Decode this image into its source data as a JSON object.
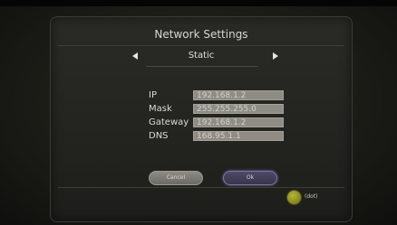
{
  "dialog": {
    "title": "Network Settings",
    "mode": {
      "value": "Static"
    },
    "fields": [
      {
        "label": "IP",
        "value": "192.168.1.2"
      },
      {
        "label": "Mask",
        "value": "255.255.255.0"
      },
      {
        "label": "Gateway",
        "value": "192.168.1.2"
      },
      {
        "label": "DNS",
        "value": "168.95.1.1"
      }
    ],
    "buttons": {
      "cancel": "Cancel",
      "ok": "Ok"
    },
    "hint": {
      "dot_label": "(dot)"
    }
  },
  "colors": {
    "accent_focus": "#7d78a6",
    "yellow_key": "#9a9b2a"
  }
}
